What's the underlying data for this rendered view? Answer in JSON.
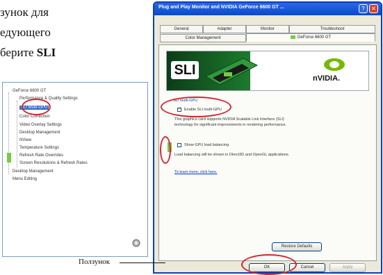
{
  "manual": {
    "line1": "зунок для",
    "line2": "едующего",
    "line3_prefix": "берите ",
    "line3_bold": "SLI",
    "caption": "Ползунок"
  },
  "tree": {
    "items": [
      "GeForce 6600 GT",
      "Performance & Quality Settings",
      "SLI Multi-GPU",
      "Color Correction",
      "Video Overlay Settings",
      "Desktop Management",
      "NView",
      "Temperature Settings",
      "Refresh Rate Overrides",
      "Screen Resolutions & Refresh Rates",
      "Desktop Management",
      "Menu Editing"
    ],
    "selected_index": 2
  },
  "window": {
    "title": "Plug and Play Monitor and NVIDIA GeForce 6600 GT ...",
    "help_glyph": "?",
    "close_glyph": "✕",
    "tabs_row1": [
      "General",
      "Adapter",
      "Monitor",
      "Troubleshoot"
    ],
    "tabs_row2": [
      "Color Management",
      "GeForce 6600 GT"
    ],
    "active_tab": "GeForce 6600 GT",
    "banner_left": "SLI",
    "banner_right": "nVIDIA.",
    "group_label": "SLI multi-GPU",
    "enable_sli_label": "Enable SLI multi-GPU",
    "enable_sli_checked": true,
    "enable_desc_1": "This graphics card supports NVIDIA Scalable Link Interface (SLI)",
    "enable_desc_2": "technology for significant improvements in rendering performance.",
    "show_balance_label": "Show GPU load balancing",
    "show_balance_desc": "Load balancing will be shown in Direct3D and OpenGL applications.",
    "learn_more": "To learn more, click here.",
    "restore_defaults": "Restore Defaults",
    "ok": "OK",
    "cancel": "Cancel",
    "apply": "Apply"
  },
  "colors": {
    "highlight_oval": "#d0282e",
    "slider_green": "#7ac943",
    "title_blue": "#0a49c9"
  }
}
